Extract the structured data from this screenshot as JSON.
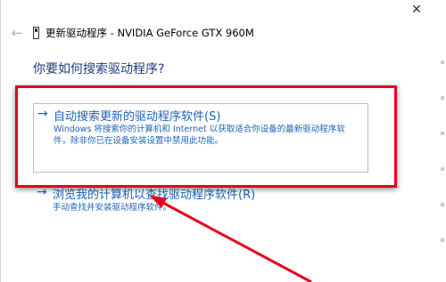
{
  "window": {
    "close_glyph": "✕",
    "back_glyph": "←",
    "title": "更新驱动程序 - NVIDIA GeForce GTX 960M"
  },
  "question": "你要如何搜索驱动程序?",
  "options": [
    {
      "arrow": "→",
      "title": "自动搜索更新的驱动程序软件(S)",
      "description": "Windows 将搜索你的计算机和 Internet 以获取适合你设备的最新驱动程序软件，除非你已在设备安装设置中禁用此功能。"
    },
    {
      "arrow": "→",
      "title": "浏览我的计算机以查找驱动程序软件(R)",
      "description": "手动查找并安装驱动程序软件。"
    }
  ],
  "colors": {
    "link": "#1e63b9",
    "heading": "#1f3b7a",
    "annotation": "#e8001d"
  },
  "icons": {
    "close": "close-icon",
    "back": "back-arrow-icon",
    "device": "device-icon",
    "option": "arrow-right-icon"
  }
}
